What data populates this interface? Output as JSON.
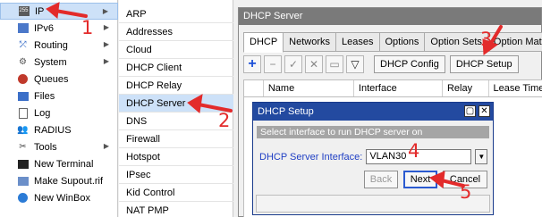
{
  "nav": {
    "items": [
      {
        "label": "IP",
        "icon": "ip-icon",
        "has_submenu": true,
        "selected": true
      },
      {
        "label": "IPv6",
        "icon": "ipv6-icon",
        "has_submenu": true
      },
      {
        "label": "Routing",
        "icon": "routing-icon",
        "has_submenu": true
      },
      {
        "label": "System",
        "icon": "system-gear-icon",
        "has_submenu": true
      },
      {
        "label": "Queues",
        "icon": "queues-icon"
      },
      {
        "label": "Files",
        "icon": "files-folder-icon"
      },
      {
        "label": "Log",
        "icon": "log-icon"
      },
      {
        "label": "RADIUS",
        "icon": "radius-users-icon"
      },
      {
        "label": "Tools",
        "icon": "tools-icon",
        "has_submenu": true
      },
      {
        "label": "New Terminal",
        "icon": "terminal-icon"
      },
      {
        "label": "Make Supout.rif",
        "icon": "supout-icon"
      },
      {
        "label": "New WinBox",
        "icon": "winbox-icon"
      }
    ]
  },
  "submenu": {
    "items": [
      {
        "label": "ARP"
      },
      {
        "label": "Addresses"
      },
      {
        "label": "Cloud"
      },
      {
        "label": "DHCP Client"
      },
      {
        "label": "DHCP Relay"
      },
      {
        "label": "DHCP Server",
        "selected": true
      },
      {
        "label": "DNS"
      },
      {
        "label": "Firewall"
      },
      {
        "label": "Hotspot"
      },
      {
        "label": "IPsec"
      },
      {
        "label": "Kid Control"
      },
      {
        "label": "NAT PMP"
      }
    ]
  },
  "dhcp_window": {
    "title": "DHCP Server",
    "tabs": [
      {
        "label": "DHCP",
        "active": true
      },
      {
        "label": "Networks"
      },
      {
        "label": "Leases"
      },
      {
        "label": "Options"
      },
      {
        "label": "Option Sets"
      },
      {
        "label": "Option Matc"
      }
    ],
    "toolbar": {
      "icons": [
        "plus-icon",
        "minus-icon",
        "check-icon",
        "cross-icon",
        "comment-icon",
        "filter-icon"
      ],
      "dhcp_config_label": "DHCP Config",
      "dhcp_setup_label": "DHCP Setup"
    },
    "columns": [
      "Name",
      "Interface",
      "Relay",
      "Lease Time"
    ]
  },
  "setup_dialog": {
    "title": "DHCP Setup",
    "banner": "Select interface to run DHCP server on",
    "field_label": "DHCP Server Interface:",
    "interface_value": "VLAN30",
    "back_label": "Back",
    "next_label": "Next",
    "cancel_label": "Cancel",
    "minimize_glyph": "▢",
    "close_glyph": "✕"
  },
  "annotations": {
    "numbers": [
      "1",
      "2",
      "3",
      "4",
      "5"
    ],
    "color": "#e32b2b"
  }
}
